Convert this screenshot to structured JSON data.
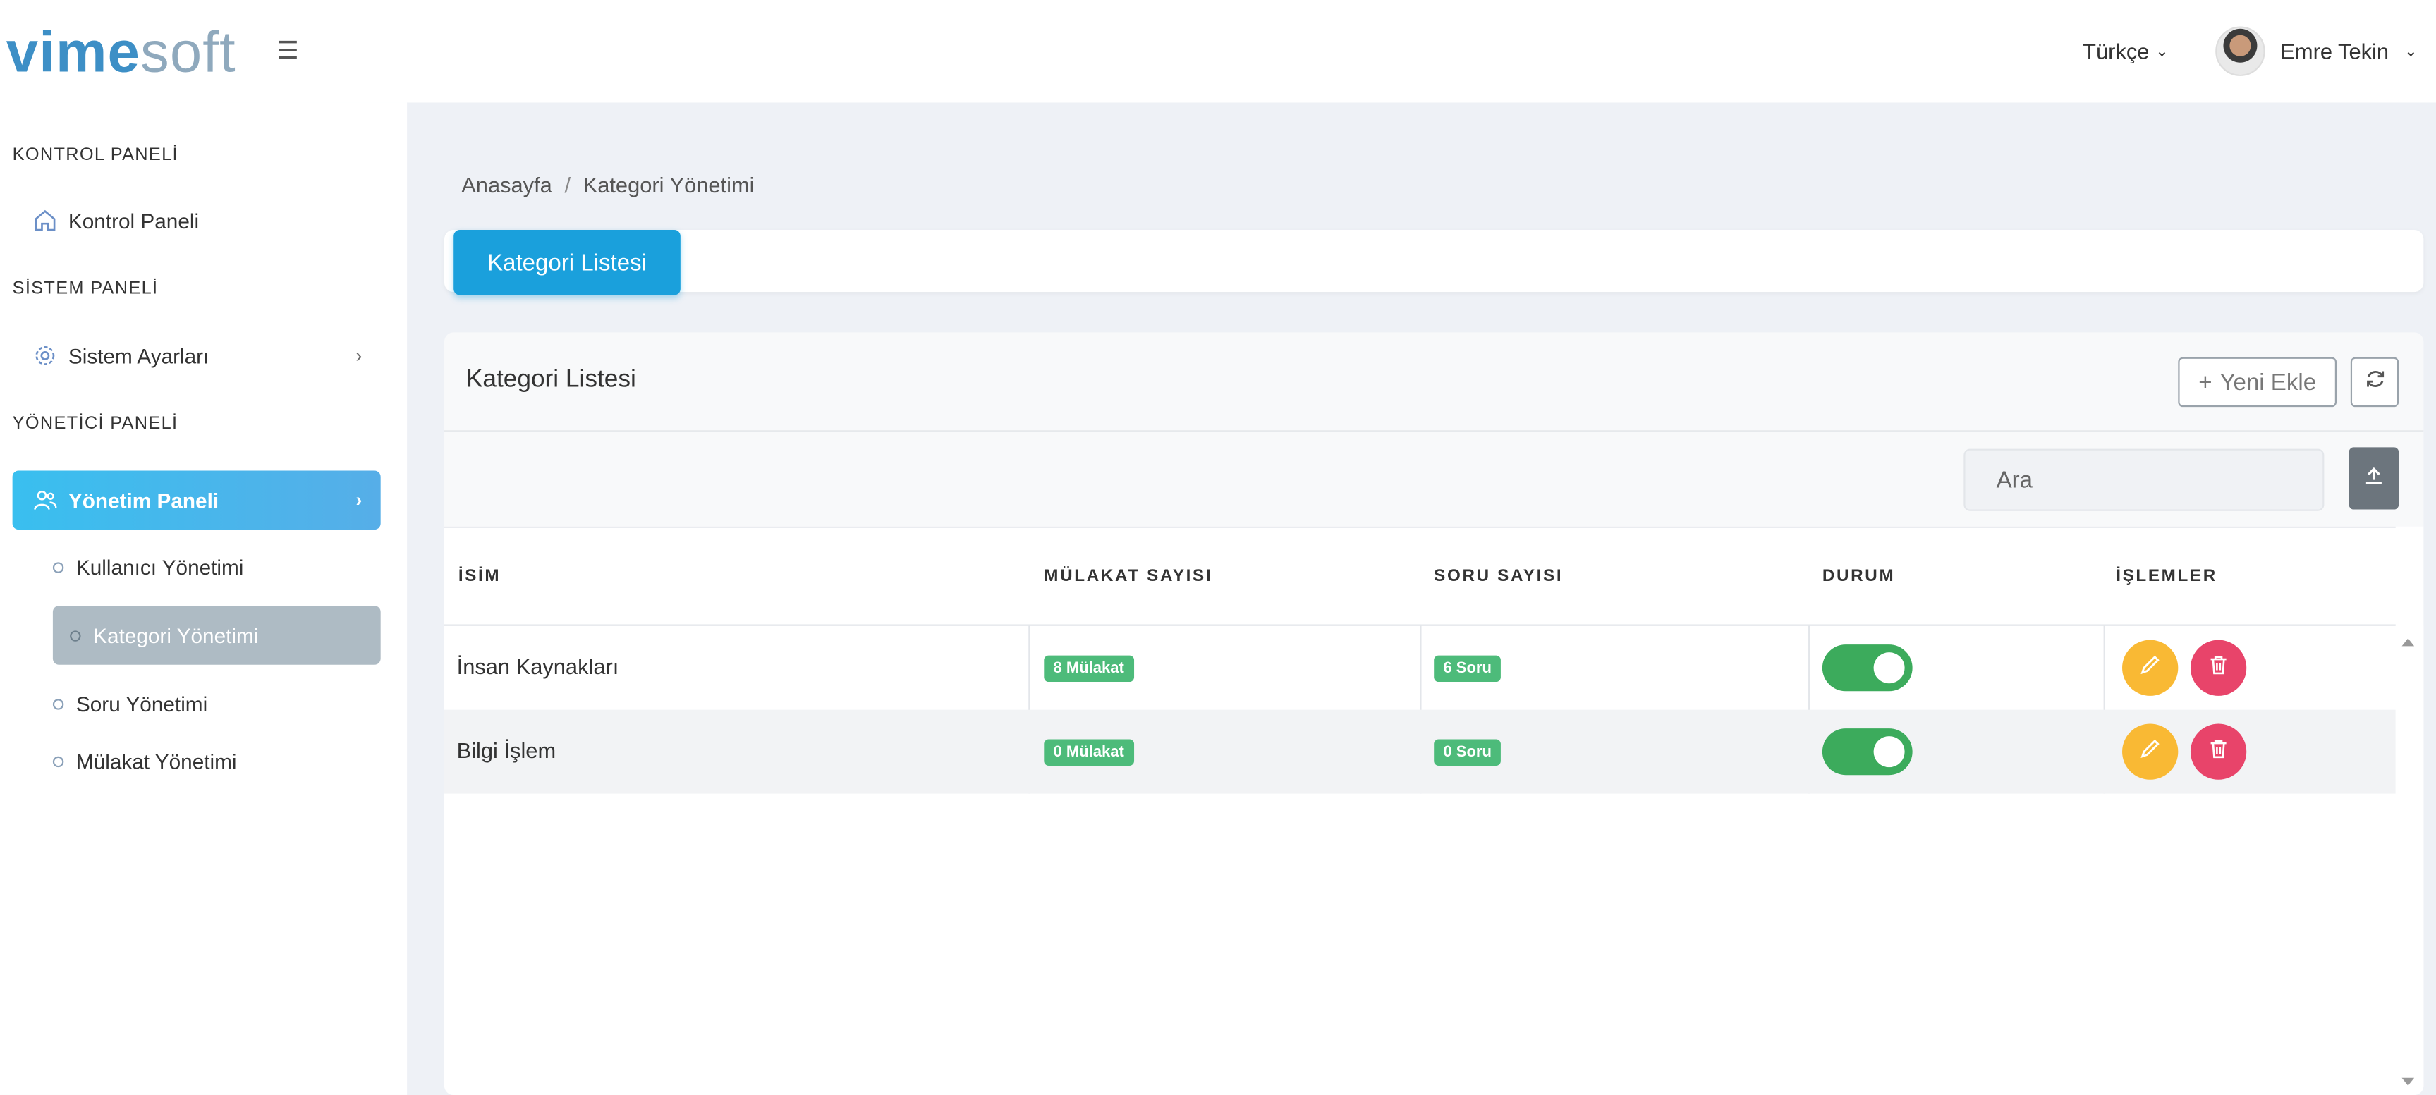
{
  "brand": {
    "logo_bold": "vime",
    "logo_light": "soft",
    "menu_icon": "hamburger-icon"
  },
  "topbar": {
    "language": "Türkçe",
    "user_name": "Emre Tekin"
  },
  "sidebar": {
    "sections": [
      {
        "title": "KONTROL PANELİ"
      },
      {
        "title": "SİSTEM PANELİ"
      },
      {
        "title": "YÖNETİCİ PANELİ"
      }
    ],
    "items": [
      {
        "label": "Kontrol Paneli",
        "icon": "home-icon"
      },
      {
        "label": "Sistem Ayarları",
        "icon": "gear-icon"
      },
      {
        "label": "Yönetim Paneli",
        "icon": "users-icon",
        "active": true
      }
    ],
    "subitems": [
      {
        "label": "Kullanıcı Yönetimi"
      },
      {
        "label": "Kategori Yönetimi",
        "active": true
      },
      {
        "label": "Soru Yönetimi"
      },
      {
        "label": "Mülakat Yönetimi"
      }
    ]
  },
  "breadcrumb": {
    "home": "Anasayfa",
    "separator": "/",
    "current": "Kategori Yönetimi"
  },
  "tabs": {
    "active": "Kategori Listesi"
  },
  "card": {
    "title": "Kategori Listesi",
    "new_button": "Yeni Ekle",
    "new_icon": "+",
    "search_placeholder": "Ara"
  },
  "table": {
    "columns": [
      "İSİM",
      "MÜLAKAT SAYISI",
      "SORU SAYISI",
      "DURUM",
      "İŞLEMLER"
    ],
    "rows": [
      {
        "name": "İnsan Kaynakları",
        "interviews": "8 Mülakat",
        "questions": "6 Soru",
        "status": true
      },
      {
        "name": "Bilgi İşlem",
        "interviews": "0 Mülakat",
        "questions": "0 Soru",
        "status": true
      }
    ]
  },
  "colors": {
    "accent": "#1aa0dc",
    "active_menu": "#39bfef",
    "badge_green": "#4dbb7a",
    "toggle_green": "#3cab5c",
    "edit_yellow": "#f9b934",
    "delete_red": "#e8446a"
  }
}
